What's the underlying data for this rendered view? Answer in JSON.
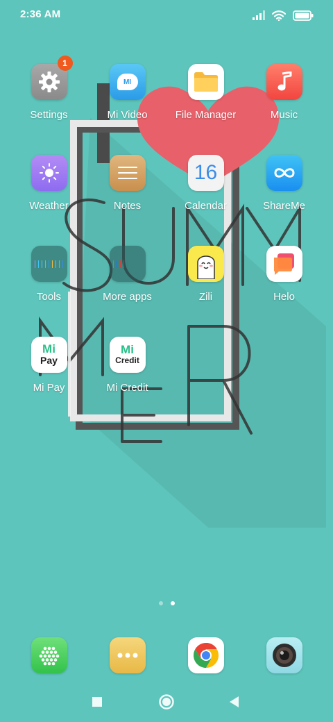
{
  "status": {
    "time": "2:36 AM",
    "icons": [
      "signal-icon",
      "wifi-icon",
      "battery-icon"
    ]
  },
  "wallpaper": {
    "text_lines": [
      "SUMM",
      "ER"
    ]
  },
  "apps": [
    {
      "label": "Settings",
      "icon": "gear-icon",
      "badge": "1"
    },
    {
      "label": "Mi Video",
      "icon": "mi-video-icon",
      "icon_text": "MI"
    },
    {
      "label": "File Manager",
      "icon": "folder-icon"
    },
    {
      "label": "Music",
      "icon": "music-note-icon"
    },
    {
      "label": "Weather",
      "icon": "sun-icon"
    },
    {
      "label": "Notes",
      "icon": "notes-icon"
    },
    {
      "label": "Calendar",
      "icon": "calendar-icon",
      "icon_text": "16"
    },
    {
      "label": "ShareMe",
      "icon": "infinity-icon"
    },
    {
      "label": "Tools",
      "icon": "folder-grid-icon"
    },
    {
      "label": "More apps",
      "icon": "folder-grid-icon"
    },
    {
      "label": "Zili",
      "icon": "zili-face-icon"
    },
    {
      "label": "Helo",
      "icon": "chat-bubble-icon"
    },
    {
      "label": "Mi Pay",
      "icon": "mi-pay-icon",
      "icon_text_top": "Mi",
      "icon_text_bottom": "Pay"
    },
    {
      "label": "Mi Credit",
      "icon": "mi-credit-icon",
      "icon_text_top": "Mi",
      "icon_text_bottom": "Credit"
    }
  ],
  "page_indicator": {
    "total": 2,
    "current": 2
  },
  "dock": [
    {
      "name": "dialer",
      "icon": "dialpad-icon"
    },
    {
      "name": "messaging",
      "icon": "ellipsis-icon"
    },
    {
      "name": "chrome",
      "icon": "chrome-icon"
    },
    {
      "name": "camera",
      "icon": "camera-icon"
    }
  ],
  "navbar": [
    "recents-square-icon",
    "home-circle-icon",
    "back-triangle-icon"
  ],
  "colors": {
    "background": "#5ec5bc",
    "badge": "#f05a1e",
    "heart": "#e8606a"
  }
}
